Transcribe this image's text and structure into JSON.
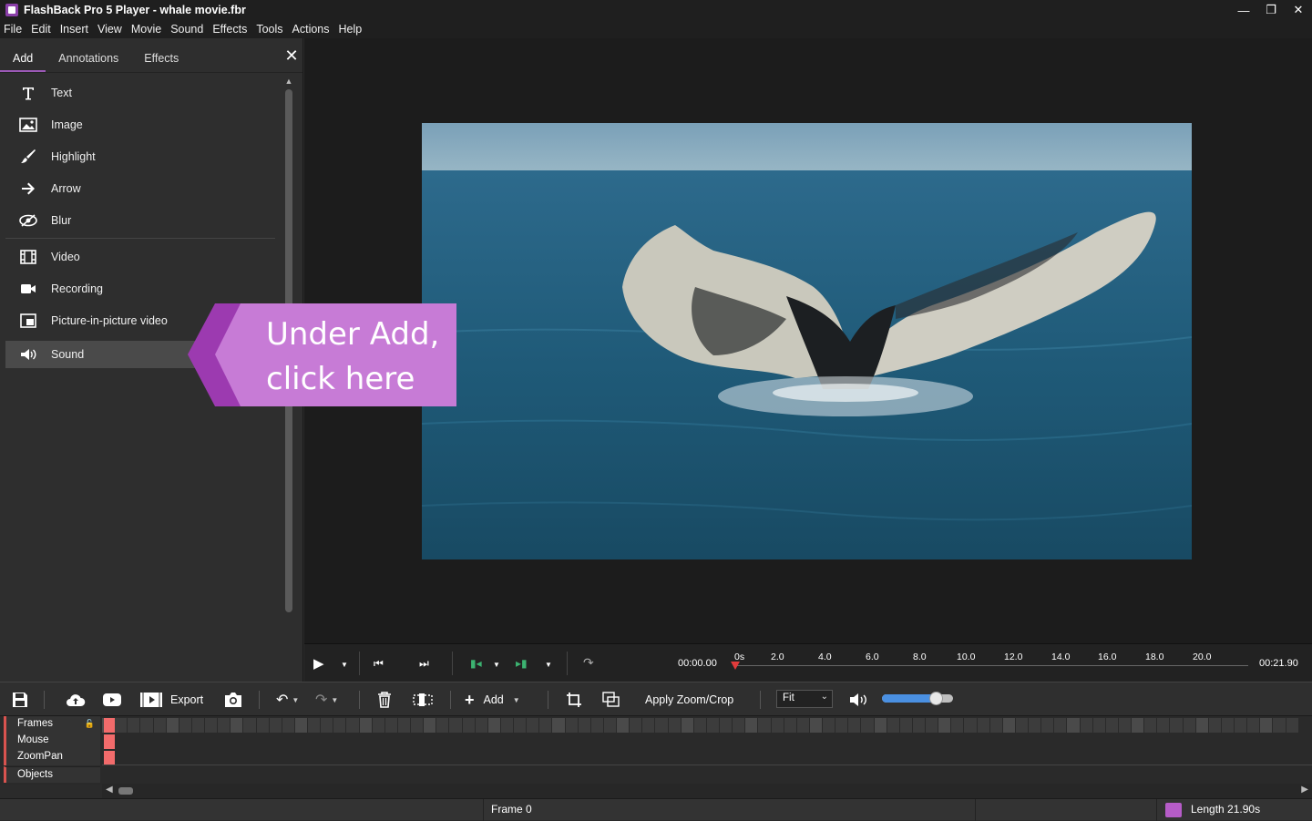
{
  "window": {
    "title": "FlashBack Pro 5 Player - whale movie.fbr",
    "controls": [
      "—",
      "❐",
      "✕"
    ]
  },
  "menu": [
    "File",
    "Edit",
    "Insert",
    "View",
    "Movie",
    "Sound",
    "Effects",
    "Tools",
    "Actions",
    "Help"
  ],
  "panel": {
    "tabs": [
      "Add",
      "Annotations",
      "Effects"
    ],
    "active_tab": "Add",
    "close": "✕",
    "items_group1": [
      {
        "label": "Text",
        "icon": "text-icon"
      },
      {
        "label": "Image",
        "icon": "image-icon"
      },
      {
        "label": "Highlight",
        "icon": "brush-icon"
      },
      {
        "label": "Arrow",
        "icon": "arrow-icon"
      },
      {
        "label": "Blur",
        "icon": "blur-icon"
      }
    ],
    "items_group2": [
      {
        "label": "Video",
        "icon": "film-icon"
      },
      {
        "label": "Recording",
        "icon": "camera-icon"
      },
      {
        "label": "Picture-in-picture video",
        "icon": "pip-icon"
      }
    ],
    "items_group3": [
      {
        "label": "Sound",
        "icon": "speaker-icon"
      }
    ]
  },
  "callout": {
    "text": "Under Add, click here",
    "color": "#b65cc8"
  },
  "playbar": {
    "current_time": "00:00.00",
    "total_time": "00:21.90",
    "ticks": [
      "0s",
      "2.0",
      "4.0",
      "6.0",
      "8.0",
      "10.0",
      "12.0",
      "14.0",
      "16.0",
      "18.0",
      "20.0"
    ]
  },
  "toolbar": {
    "export_label": "Export",
    "add_label": "Add",
    "apply_zoom_label": "Apply Zoom/Crop",
    "fit_value": "Fit",
    "volume": 0.77
  },
  "tracks": [
    "Frames",
    "Mouse",
    "ZoomPan",
    "Objects"
  ],
  "status": {
    "frame": "Frame 0",
    "length": "Length 21.90s"
  },
  "colors": {
    "accent": "#9b59b6",
    "callout": "#b65cc8",
    "track_marker": "#f26b6b",
    "playhead": "#e23b3b"
  }
}
